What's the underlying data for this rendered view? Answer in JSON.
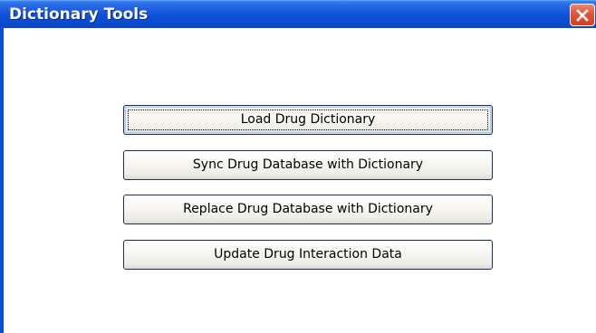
{
  "window": {
    "title": "Dictionary Tools",
    "close_icon": "close-icon",
    "colors": {
      "titlebar": "#0d50d8",
      "close_button": "#e0553a",
      "button_border": "#1c2f5a"
    }
  },
  "buttons": [
    {
      "label": "Load Drug Dictionary",
      "focused": true
    },
    {
      "label": "Sync Drug Database with Dictionary",
      "focused": false
    },
    {
      "label": "Replace Drug Database with Dictionary",
      "focused": false
    },
    {
      "label": "Update Drug Interaction Data",
      "focused": false
    }
  ]
}
